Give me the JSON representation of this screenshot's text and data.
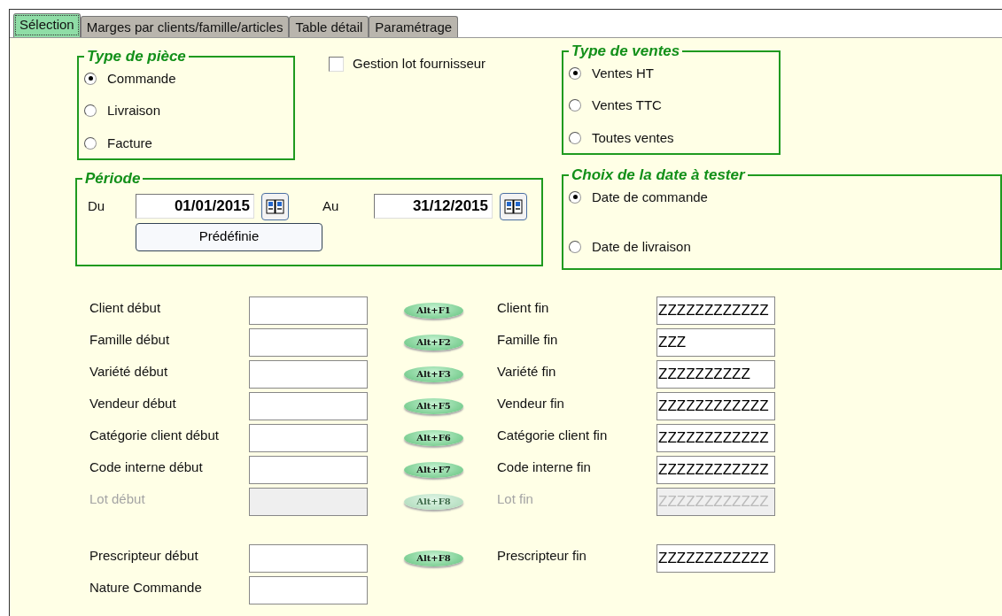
{
  "tabs": [
    {
      "label": "Sélection",
      "selected": true
    },
    {
      "label": "Marges par clients/famille/articles",
      "selected": false
    },
    {
      "label": "Table détail",
      "selected": false
    },
    {
      "label": "Paramétrage",
      "selected": false
    }
  ],
  "type_de_piece": {
    "legend": "Type de pièce",
    "options": [
      {
        "label": "Commande",
        "selected": true
      },
      {
        "label": "Livraison",
        "selected": false
      },
      {
        "label": "Facture",
        "selected": false
      }
    ]
  },
  "gestion_lot": {
    "label": "Gestion lot fournisseur",
    "checked": false
  },
  "type_de_ventes": {
    "legend": "Type de ventes",
    "options": [
      {
        "label": "Ventes HT",
        "selected": true
      },
      {
        "label": "Ventes TTC",
        "selected": false
      },
      {
        "label": "Toutes ventes",
        "selected": false
      }
    ]
  },
  "periode": {
    "legend": "Période",
    "from_label": "Du",
    "from": "01/01/2015",
    "to_label": "Au",
    "to": "31/12/2015",
    "button": "Prédéfinie"
  },
  "choix_date": {
    "legend": "Choix de la date à tester",
    "options": [
      {
        "label": "Date de commande",
        "selected": true
      },
      {
        "label": "Date de livraison",
        "selected": false
      }
    ]
  },
  "ranges": [
    {
      "start_label": "Client début",
      "shortcut": "Alt+F1",
      "end_label": "Client fin",
      "end_value": "ZZZZZZZZZZZZ",
      "disabled": false
    },
    {
      "start_label": "Famille début",
      "shortcut": "Alt+F2",
      "end_label": "Famille fin",
      "end_value": "ZZZ",
      "disabled": false
    },
    {
      "start_label": "Variété début",
      "shortcut": "Alt+F3",
      "end_label": "Variété fin",
      "end_value": "ZZZZZZZZZZ",
      "disabled": false
    },
    {
      "start_label": "Vendeur début",
      "shortcut": "Alt+F5",
      "end_label": "Vendeur fin",
      "end_value": "ZZZZZZZZZZZZ",
      "disabled": false
    },
    {
      "start_label": "Catégorie client début",
      "shortcut": "Alt+F6",
      "end_label": "Catégorie client fin",
      "end_value": "ZZZZZZZZZZZZ",
      "disabled": false
    },
    {
      "start_label": "Code interne début",
      "shortcut": "Alt+F7",
      "end_label": "Code interne fin",
      "end_value": "ZZZZZZZZZZZZ",
      "disabled": false
    },
    {
      "start_label": "Lot début",
      "shortcut": "Alt+F8",
      "end_label": "Lot fin",
      "end_value": "ZZZZZZZZZZZZ",
      "disabled": true
    }
  ],
  "extra_ranges": [
    {
      "start_label": "Prescripteur début",
      "shortcut": "Alt+F8",
      "end_label": "Prescripteur fin",
      "end_value": "ZZZZZZZZZZZZ",
      "disabled": false
    },
    {
      "start_label": "Nature Commande",
      "disabled": false
    }
  ]
}
